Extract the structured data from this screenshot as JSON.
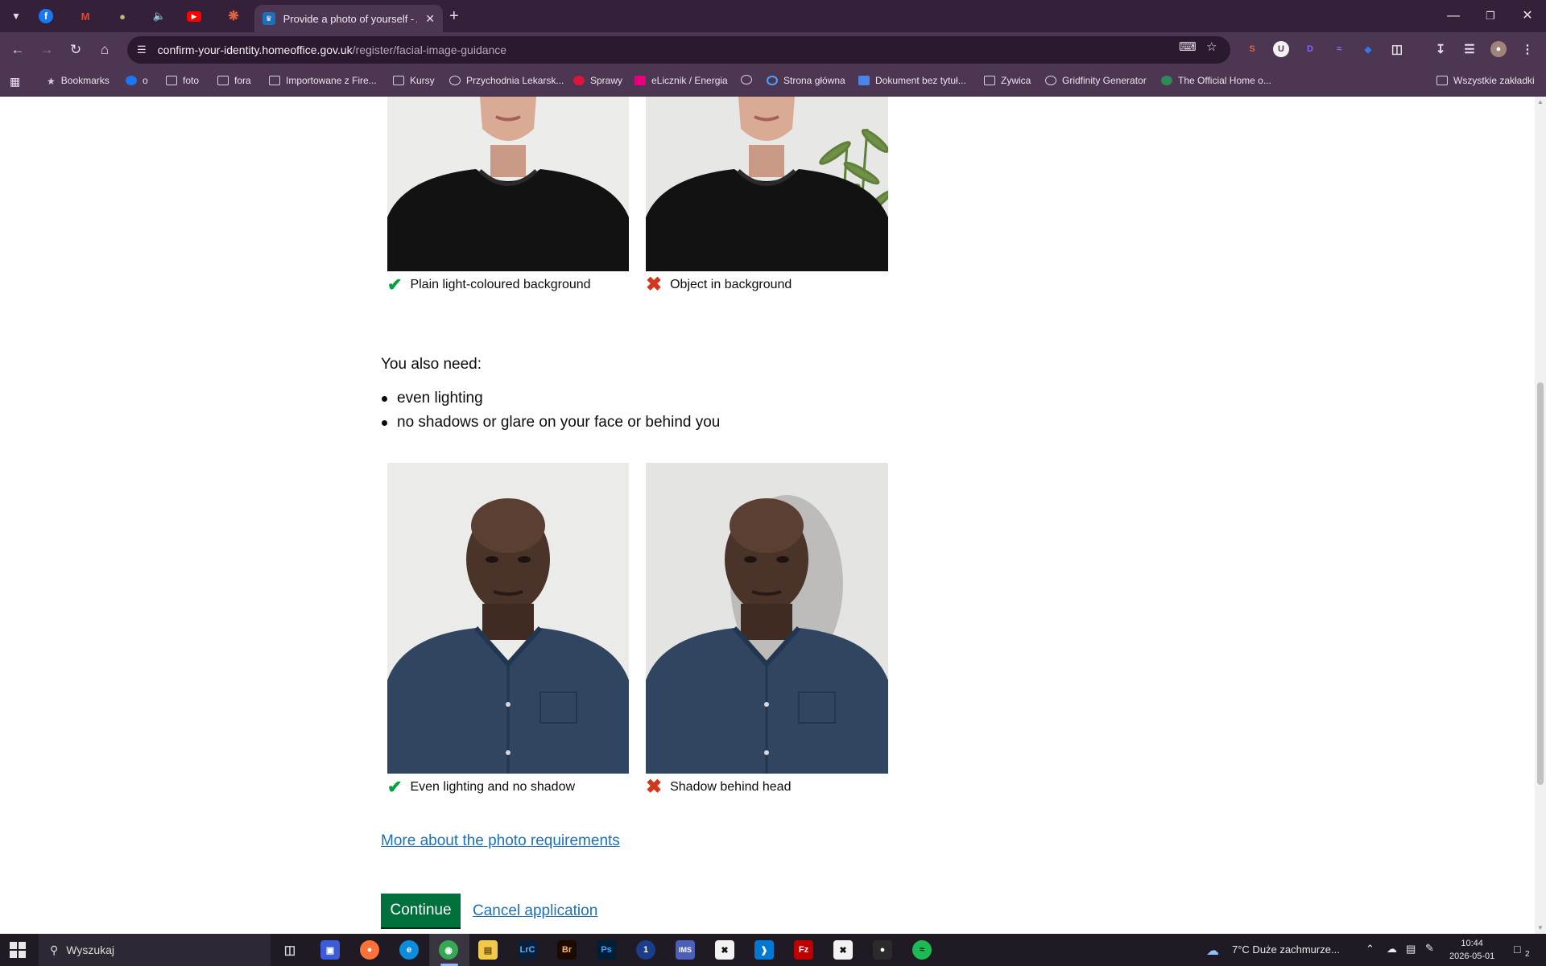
{
  "browser": {
    "active_tab_title": "Provide a photo of yourself - Ap",
    "url_host": "confirm-your-identity.homeoffice.gov.uk",
    "url_path": "/register/facial-image-guidance"
  },
  "bookmarks": [
    {
      "label": "Bookmarks",
      "icon": "star-icon"
    },
    {
      "label": "o",
      "icon": "facebook-icon"
    },
    {
      "label": "foto",
      "icon": "folder-icon"
    },
    {
      "label": "fora",
      "icon": "folder-icon"
    },
    {
      "label": "Importowane z Fire...",
      "icon": "folder-icon"
    },
    {
      "label": "Kursy",
      "icon": "folder-icon"
    },
    {
      "label": "Przychodnia Lekarsk...",
      "icon": "globe-icon"
    },
    {
      "label": "Sprawy",
      "icon": "eagle-icon"
    },
    {
      "label": "eLicznik / Energia",
      "icon": "energy-icon"
    },
    {
      "label": "",
      "icon": "globe-icon"
    },
    {
      "label": "Strona główna",
      "icon": "home-site-icon"
    },
    {
      "label": "Dokument bez tytuł...",
      "icon": "doc-icon"
    },
    {
      "label": "Zywica",
      "icon": "folder-icon"
    },
    {
      "label": "Gridfinity Generator",
      "icon": "globe-icon"
    },
    {
      "label": "The Official Home o...",
      "icon": "site-icon"
    },
    {
      "label": "Wszystkie zakładki",
      "icon": "folder-icon"
    }
  ],
  "page": {
    "top_examples": [
      {
        "caption": "Plain light-coloured background",
        "verdict": "good"
      },
      {
        "caption": "Object in background",
        "verdict": "bad"
      }
    ],
    "lead": "You also need:",
    "requirements": [
      "even lighting",
      "no shadows or glare on your face or behind you"
    ],
    "bottom_examples": [
      {
        "caption": "Even lighting and no shadow",
        "verdict": "good"
      },
      {
        "caption": "Shadow behind head",
        "verdict": "bad"
      }
    ],
    "more_link": "More about the photo requirements",
    "continue_label": "Continue",
    "cancel_label": "Cancel application"
  },
  "taskbar": {
    "search_placeholder": "Wyszukaj",
    "weather": "7°C  Duże zachmurze...",
    "time": "10:44",
    "date": "2026-05-01",
    "notifications": "2"
  },
  "colors": {
    "govuk_green": "#00703c",
    "govuk_link": "#1d70b8",
    "tick": "#00a33b",
    "cross": "#d4351c",
    "chrome_frame": "#35203a"
  }
}
